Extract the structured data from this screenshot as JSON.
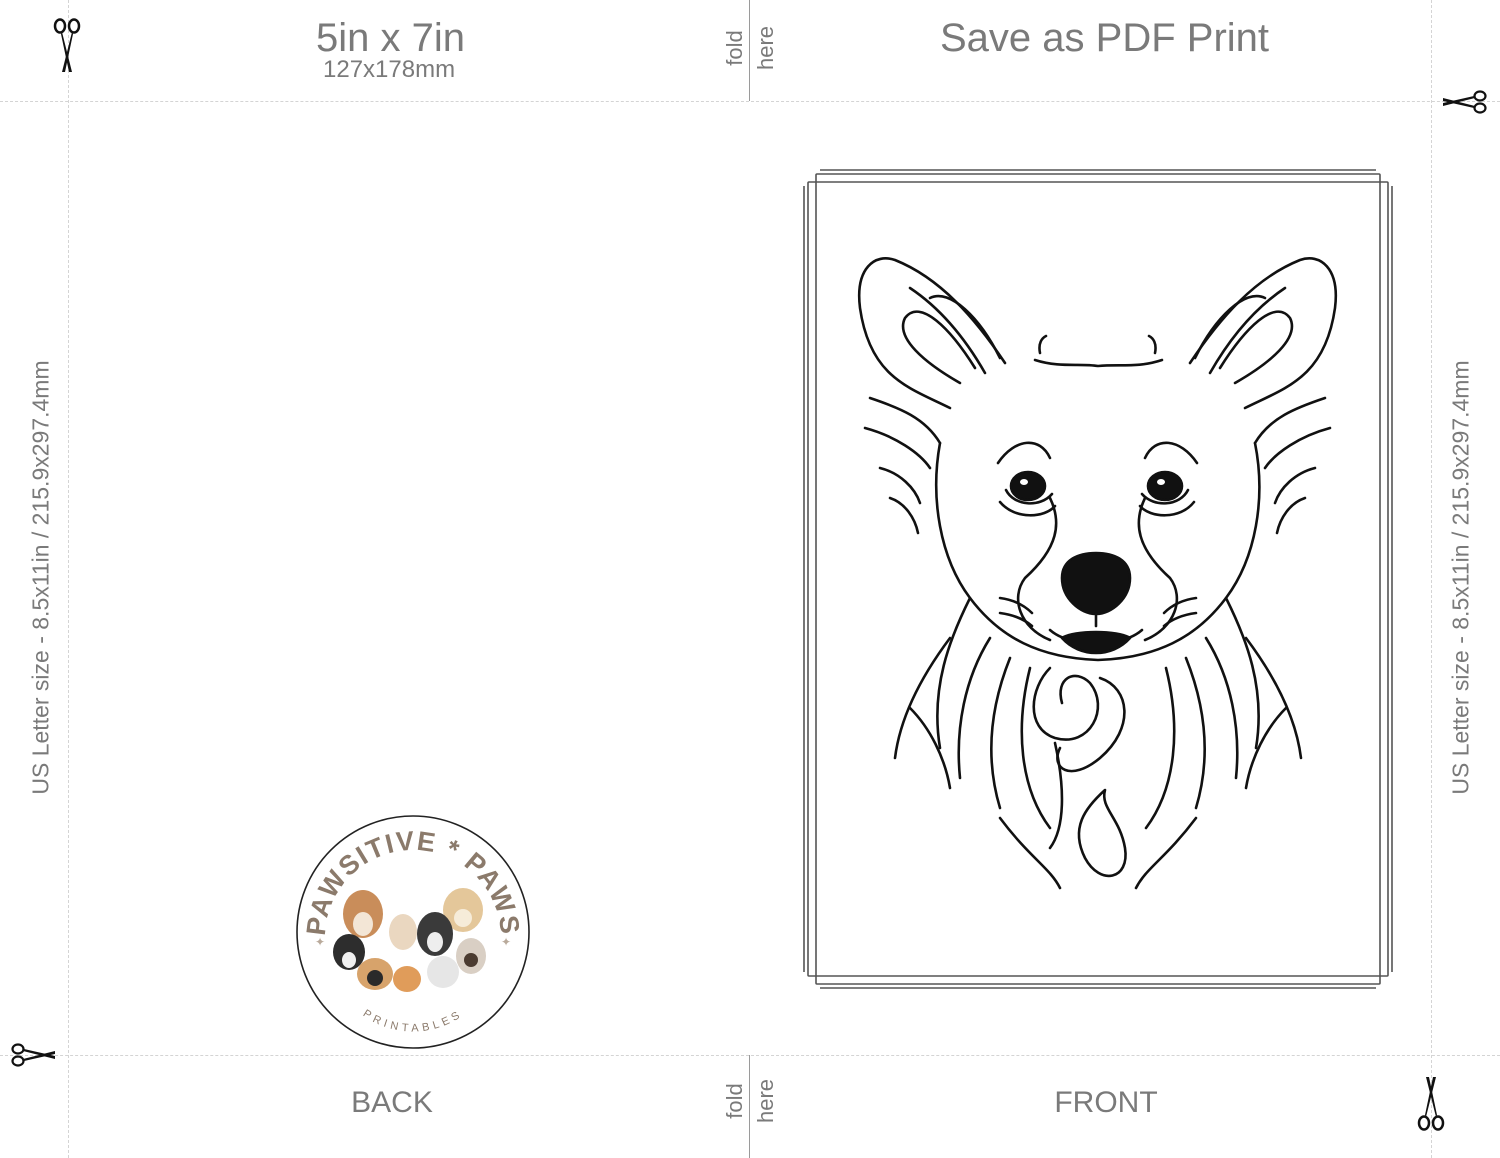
{
  "card_size": {
    "imperial": "5in x 7in",
    "metric": "127x178mm"
  },
  "instruction": "Save as PDF Print",
  "fold_label": {
    "word1": "fold",
    "word2": "here"
  },
  "paper_size_label": "US Letter size - 8.5x11in / 215.9x297.4mm",
  "panels": {
    "back": "BACK",
    "front": "FRONT"
  },
  "logo": {
    "arc_text": "PAWSITIVE * PAWS",
    "sub_text": "PRINTABLES"
  },
  "icons": {
    "scissors": "scissors-icon"
  },
  "colors": {
    "text": "#7a7a7a",
    "guide": "#d4d4d4",
    "logo_text": "#8b7a6b",
    "line_art": "#111111"
  }
}
